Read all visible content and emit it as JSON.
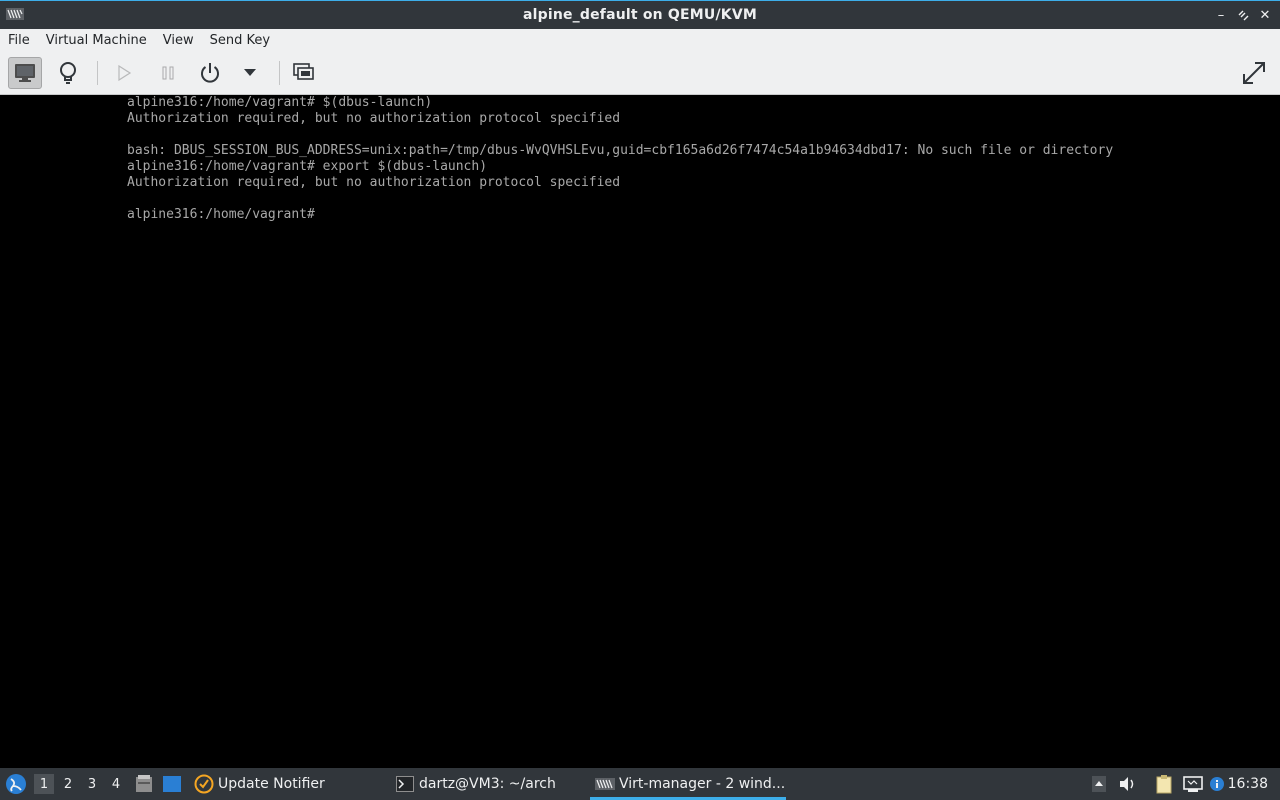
{
  "window": {
    "title": "alpine_default on QEMU/KVM"
  },
  "menubar": {
    "items": [
      "File",
      "Virtual Machine",
      "View",
      "Send Key"
    ]
  },
  "toolbar": {
    "buttons": [
      "console-view",
      "details-view",
      "run",
      "pause",
      "shutdown",
      "shutdown-menu",
      "snapshots",
      "fullscreen"
    ]
  },
  "console": {
    "lines": [
      "alpine316:/home/vagrant# $(dbus-launch)",
      "Authorization required, but no authorization protocol specified",
      "",
      "bash: DBUS_SESSION_BUS_ADDRESS=unix:path=/tmp/dbus-WvQVHSLEvu,guid=cbf165a6d26f7474c54a1b94634dbd17: No such file or directory",
      "alpine316:/home/vagrant# export $(dbus-launch)",
      "Authorization required, but no authorization protocol specified",
      "",
      "alpine316:/home/vagrant#"
    ]
  },
  "taskbar": {
    "workspaces": [
      "1",
      "2",
      "3",
      "4"
    ],
    "active_workspace": "1",
    "tasks": [
      {
        "label": "Update Notifier",
        "icon": "update-notifier-icon"
      },
      {
        "label": "dartz@VM3: ~/arch",
        "icon": "terminal-icon"
      },
      {
        "label": "Virt-manager - 2 wind...",
        "icon": "virt-manager-icon",
        "active": true
      }
    ],
    "clock": "16:38"
  },
  "colors": {
    "titlebar": "#31363b",
    "accent": "#3daee9",
    "menubar": "#eff0f1",
    "console_text": "#a8a8a8"
  }
}
